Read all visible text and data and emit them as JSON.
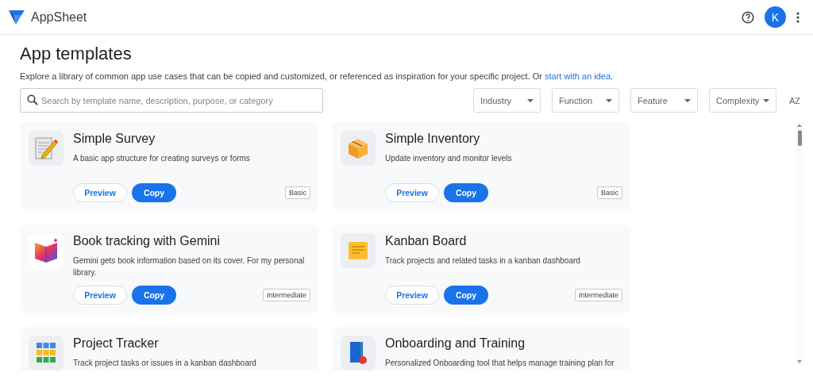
{
  "header": {
    "brand": "AppSheet",
    "avatar": "K"
  },
  "page": {
    "title": "App templates",
    "description": "Explore a library of common app use cases that can be copied and customized, or referenced as inspiration for your specific project. Or ",
    "description_link": "start with an idea",
    "description_end": "."
  },
  "search": {
    "placeholder": "Search by template name, description, purpose, or category"
  },
  "filters": [
    "Industry",
    "Function",
    "Feature",
    "Complexity"
  ],
  "sort_label": "AZ",
  "templates": [
    {
      "title": "Simple Survey",
      "description": "A basic app structure for creating surveys or forms",
      "preview": "Preview",
      "copy": "Copy",
      "level": "Basic"
    },
    {
      "title": "Simple Inventory",
      "description": "Update inventory and monitor levels",
      "preview": "Preview",
      "copy": "Copy",
      "level": "Basic"
    },
    {
      "title": "Book tracking with Gemini",
      "description": "Gemini gets book information based on its cover. For my personal library.",
      "preview": "Preview",
      "copy": "Copy",
      "level": "Intermediate"
    },
    {
      "title": "Kanban Board",
      "description": "Track projects and related tasks in a kanban dashboard",
      "preview": "Preview",
      "copy": "Copy",
      "level": "Intermediate"
    },
    {
      "title": "Project Tracker",
      "description": "Track project tasks or issues in a kanban dashboard"
    },
    {
      "title": "Onboarding and Training",
      "description": "Personalized Onboarding tool that helps manage training plan for"
    }
  ]
}
